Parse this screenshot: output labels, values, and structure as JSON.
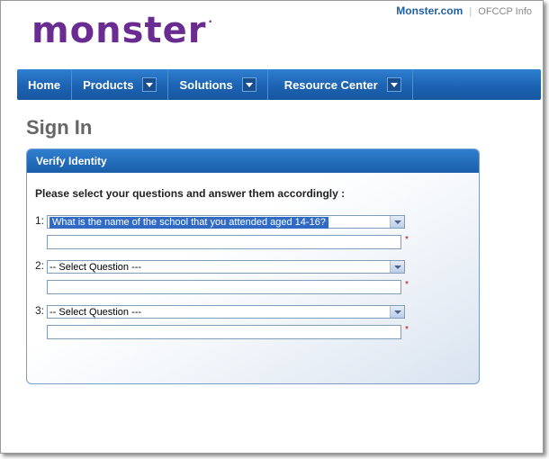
{
  "header": {
    "site_link": "Monster.com",
    "separator": "|",
    "ofccp_link": "OFCCP Info",
    "logo_text": "monster",
    "logo_mark": "·"
  },
  "nav": {
    "items": [
      {
        "label": "Home",
        "has_dropdown": false
      },
      {
        "label": "Products",
        "has_dropdown": true
      },
      {
        "label": "Solutions",
        "has_dropdown": true
      },
      {
        "label": "Resource Center",
        "has_dropdown": true
      }
    ]
  },
  "page": {
    "title": "Sign In"
  },
  "panel": {
    "heading": "Verify Identity",
    "instructions": "Please select your questions and answer them accordingly :",
    "questions": [
      {
        "number": "1:",
        "selected": "What is the name of the school that you attended aged 14-16?",
        "answer": "",
        "required_mark": "*"
      },
      {
        "number": "2:",
        "selected": "-- Select Question ---",
        "answer": "",
        "required_mark": "*"
      },
      {
        "number": "3:",
        "selected": "-- Select Question ---",
        "answer": "",
        "required_mark": "*"
      }
    ]
  },
  "colors": {
    "brand_purple": "#6a2c91",
    "nav_blue": "#1d63b3",
    "selection_blue": "#316ac5",
    "required_red": "#cc0000"
  }
}
